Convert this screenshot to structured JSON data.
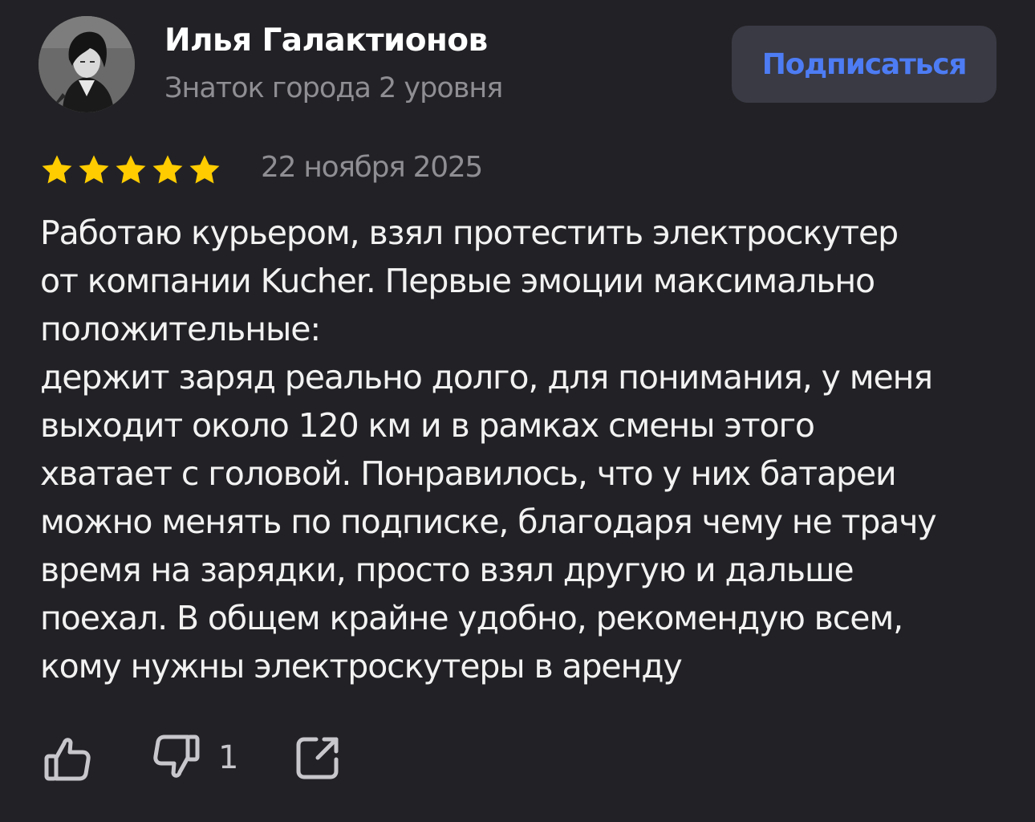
{
  "author": {
    "name": "Илья Галактионов",
    "level": "Знаток города 2 уровня",
    "avatar_icon": "user-avatar-photo"
  },
  "subscribe_button": {
    "label": "Подписаться",
    "color": "#4d7cf4"
  },
  "review": {
    "rating": 5,
    "rating_max": 5,
    "star_color": "#ffcc00",
    "date": "22 ноября 2025",
    "text": "Работаю курьером, взял протестить электроскутер\nот компании Kucher. Первые эмоции максимально\nположительные:\nдержит заряд реально долго, для понимания, у меня\nвыходит около 120 км и в рамках смены этого\nхватает с головой. Понравилось, что у них батареи\nможно менять по подписке, благодаря чему не трачу\nвремя на зарядки, просто взял другую и дальше\nпоехал. В общем крайне удобно, рекомендую всем,\nкому нужны электроскутеры в аренду"
  },
  "actions": {
    "like_icon": "thumbs-up-icon",
    "dislike_icon": "thumbs-down-icon",
    "dislike_count": "1",
    "share_icon": "share-icon"
  },
  "colors": {
    "background": "#222226",
    "secondary_text": "#8e8e93",
    "button_background": "#393a44"
  }
}
